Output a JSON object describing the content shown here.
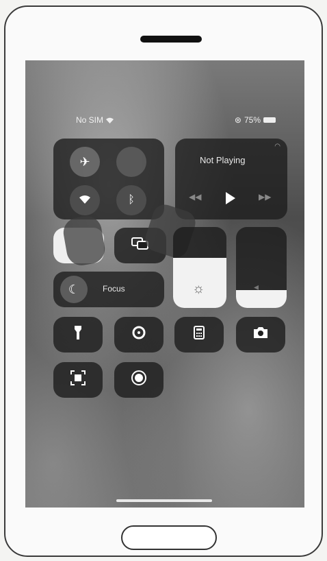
{
  "status_bar": {
    "carrier": "No SIM",
    "battery": "75%"
  },
  "connectivity": {
    "airplane_icon": "airplane-icon",
    "cellular_icon": "cellular-icon",
    "wifi_icon": "wifi-icon",
    "bluetooth_icon": "bluetooth-icon"
  },
  "media": {
    "title": "Not Playing"
  },
  "focus": {
    "label": "Focus"
  },
  "sliders": {
    "brightness_level": 0.62,
    "volume_level": 0.22
  },
  "colors": {
    "tile_bg": "#1c1c1c",
    "slider_fill": "#f2f2f2"
  }
}
